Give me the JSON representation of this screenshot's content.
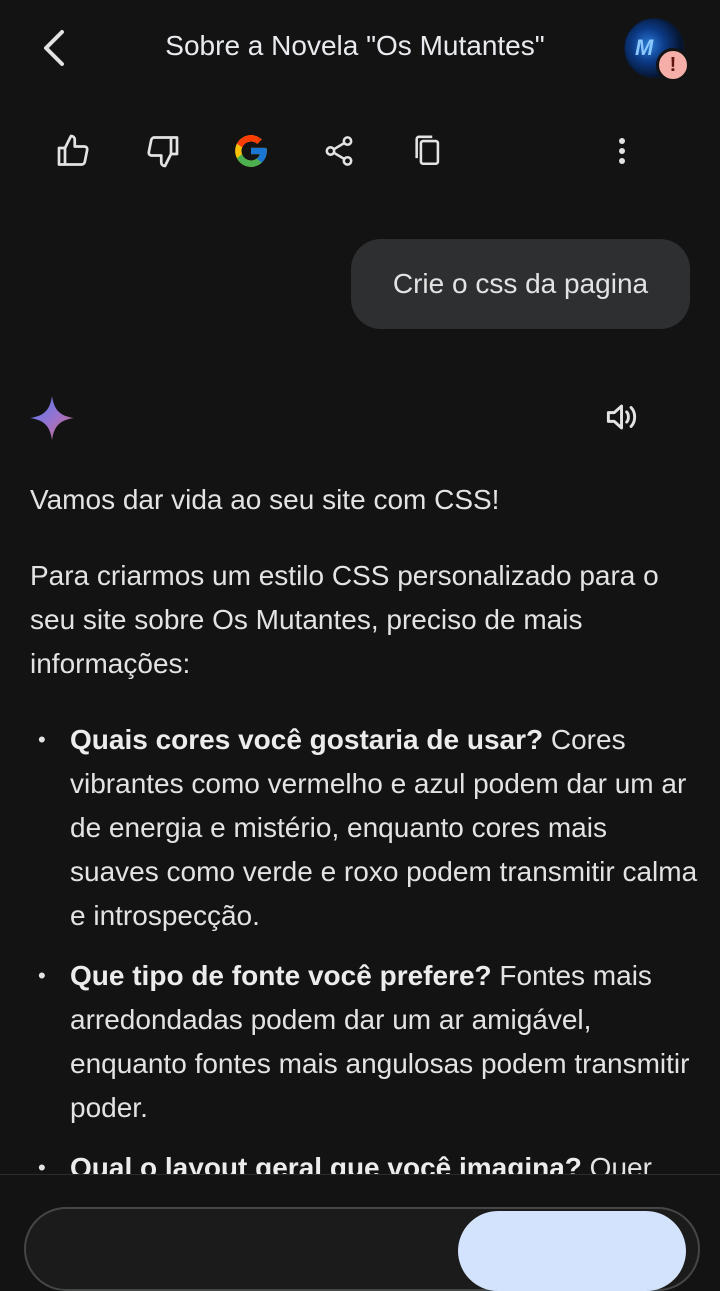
{
  "header": {
    "title": "Sobre a Novela \"Os Mutantes\""
  },
  "user_message": "Crie o css da pagina",
  "response": {
    "intro": "Vamos dar vida ao seu site com CSS!",
    "paragraph": "Para criarmos um estilo CSS personalizado para o seu site sobre Os Mutantes, preciso de mais informações:",
    "bullets": [
      {
        "question": "Quais cores você gostaria de usar?",
        "text": " Cores vibrantes como vermelho e azul podem dar um ar de energia e mistério, enquanto cores mais suaves como verde e roxo podem transmitir calma e introspecção."
      },
      {
        "question": "Que tipo de fonte você prefere?",
        "text": " Fontes mais arredondadas podem dar um ar amigável, enquanto fontes mais angulosas podem transmitir poder."
      },
      {
        "question": "Qual o layout geral que você imagina?",
        "text": " Quer"
      }
    ]
  },
  "icons": {
    "back": "arrow-back-icon",
    "like": "thumbs-up-icon",
    "dislike": "thumbs-down-icon",
    "google": "google-g-icon",
    "share": "share-icon",
    "copy": "copy-icon",
    "more": "more-vert-icon",
    "gemini": "gemini-sparkle-icon",
    "speaker": "speaker-icon",
    "alert": "alert-badge-icon"
  },
  "colors": {
    "background": "#131314",
    "bubble": "#2e2f31",
    "text": "#e3e3e3",
    "alert_badge": "#f6aea9",
    "send_pill": "#d3e3fd"
  }
}
